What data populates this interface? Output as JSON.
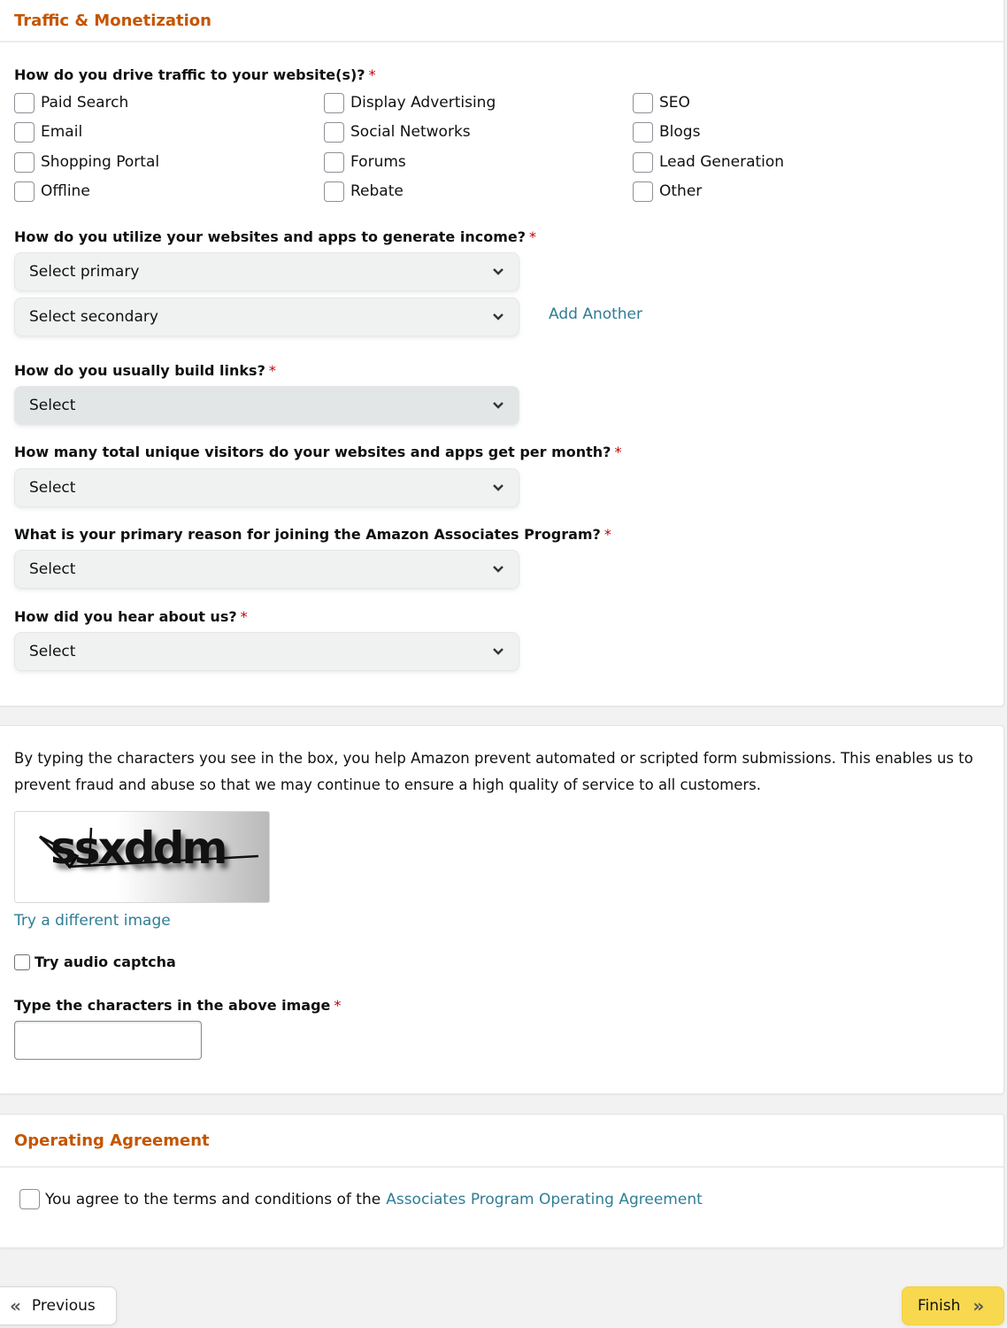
{
  "traffic_section": {
    "title": "Traffic & Monetization",
    "q_traffic": {
      "label": "How do you drive traffic to your website(s)?",
      "required": "*"
    },
    "traffic_options": [
      [
        "Paid Search",
        "Display Advertising",
        "SEO"
      ],
      [
        "Email",
        "Social Networks",
        "Blogs"
      ],
      [
        "Shopping Portal",
        "Forums",
        "Lead Generation"
      ],
      [
        "Offline",
        "Rebate",
        "Other"
      ]
    ],
    "q_income": {
      "label": "How do you utilize your websites and apps to generate income?",
      "required": "*",
      "primary_value": "Select primary",
      "secondary_value": "Select secondary",
      "add_another": "Add Another"
    },
    "q_links": {
      "label": "How do you usually build links?",
      "required": "*",
      "value": "Select"
    },
    "q_visitors": {
      "label": "How many total unique visitors do your websites and apps get per month?",
      "required": "*",
      "value": "Select"
    },
    "q_reason": {
      "label": "What is your primary reason for joining the Amazon Associates Program?",
      "required": "*",
      "value": "Select"
    },
    "q_hear": {
      "label": "How did you hear about us?",
      "required": "*",
      "value": "Select"
    }
  },
  "captcha_section": {
    "intro_line1": "By typing the characters you see in the box, you help Amazon prevent automated or scripted form submissions. This enables us to",
    "intro_line2": "prevent fraud and abuse so that we may continue to ensure a high quality of service to all customers.",
    "captcha_text": "ssxddm",
    "different_image": "Try a different image",
    "audio_captcha": "Try audio captcha",
    "input_label": "Type the characters in the above image",
    "required": "*",
    "input_value": ""
  },
  "agreement_section": {
    "title": "Operating Agreement",
    "agree_text": "You agree to the terms and conditions of the",
    "agree_link": "Associates Program Operating Agreement"
  },
  "nav": {
    "previous": "Previous",
    "finish": "Finish",
    "prev_icon": "«",
    "next_icon": "»"
  },
  "colors": {
    "section_title": "#c45500",
    "link": "#2f7d95",
    "required": "#c40000",
    "finish_button": "#f8d84e"
  }
}
